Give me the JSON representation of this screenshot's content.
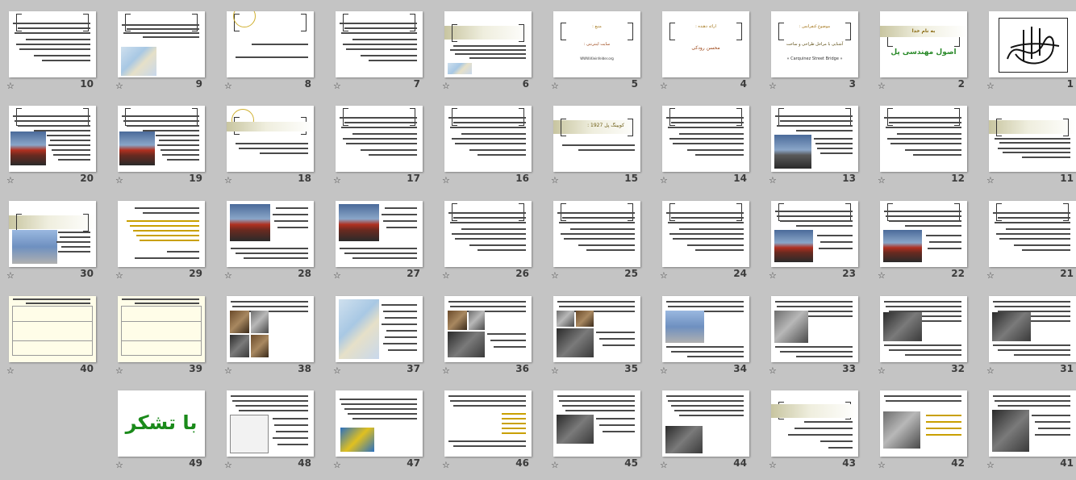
{
  "sorter": {
    "star_glyph": "☆",
    "slides": [
      {
        "number": "1",
        "layout": "logo"
      },
      {
        "number": "2",
        "layout": "title",
        "heading": "به نام خدا",
        "title": "اصول مهندسی پل"
      },
      {
        "number": "3",
        "layout": "title3",
        "title": "موضوع کنفرانس :",
        "line1": "آشنایی با مراحل طراحی و ساخت",
        "line2": "« Carquinez Street Bridge »"
      },
      {
        "number": "4",
        "layout": "title4",
        "title": "ارائه دهنده :",
        "line1": "محسن رودکی"
      },
      {
        "number": "5",
        "layout": "title5",
        "title": "منبع :",
        "line1": "سایت اینترنتی :",
        "line2": "WWW.Kleinfelder.org"
      },
      {
        "number": "6",
        "layout": "band"
      },
      {
        "number": "7",
        "layout": "text"
      },
      {
        "number": "8",
        "layout": "text-circle"
      },
      {
        "number": "9",
        "layout": "map"
      },
      {
        "number": "10",
        "layout": "text"
      },
      {
        "number": "11",
        "layout": "band-text"
      },
      {
        "number": "12",
        "layout": "text"
      },
      {
        "number": "13",
        "layout": "photo-left"
      },
      {
        "number": "14",
        "layout": "text"
      },
      {
        "number": "15",
        "layout": "band-short",
        "title": "کویینگ پل 1927 :"
      },
      {
        "number": "16",
        "layout": "text"
      },
      {
        "number": "17",
        "layout": "text"
      },
      {
        "number": "18",
        "layout": "circle-text"
      },
      {
        "number": "19",
        "layout": "photo-red"
      },
      {
        "number": "20",
        "layout": "photo-red"
      },
      {
        "number": "21",
        "layout": "text"
      },
      {
        "number": "22",
        "layout": "photo-red-mid"
      },
      {
        "number": "23",
        "layout": "photo-red-mid"
      },
      {
        "number": "24",
        "layout": "text"
      },
      {
        "number": "25",
        "layout": "text"
      },
      {
        "number": "26",
        "layout": "text"
      },
      {
        "number": "27",
        "layout": "photo-red-top"
      },
      {
        "number": "28",
        "layout": "photo-red-top"
      },
      {
        "number": "29",
        "layout": "bullets-gold"
      },
      {
        "number": "30",
        "layout": "band-photo"
      },
      {
        "number": "31",
        "layout": "photo-dark"
      },
      {
        "number": "32",
        "layout": "photo-dark"
      },
      {
        "number": "33",
        "layout": "photo-gray"
      },
      {
        "number": "34",
        "layout": "photo-blue"
      },
      {
        "number": "35",
        "layout": "photo-grid"
      },
      {
        "number": "36",
        "layout": "photo-grid2"
      },
      {
        "number": "37",
        "layout": "diagram"
      },
      {
        "number": "38",
        "layout": "photo-grid3"
      },
      {
        "number": "39",
        "layout": "drawing"
      },
      {
        "number": "40",
        "layout": "drawing"
      },
      {
        "number": "41",
        "layout": "photo-bottom"
      },
      {
        "number": "42",
        "layout": "photo-left-list"
      },
      {
        "number": "43",
        "layout": "band-list"
      },
      {
        "number": "44",
        "layout": "photo-bottom-left"
      },
      {
        "number": "45",
        "layout": "photo-mid"
      },
      {
        "number": "46",
        "layout": "gold-list"
      },
      {
        "number": "47",
        "layout": "diagram2"
      },
      {
        "number": "48",
        "layout": "drawing2"
      },
      {
        "number": "49",
        "layout": "thanks",
        "title": "با تشکر"
      }
    ]
  }
}
